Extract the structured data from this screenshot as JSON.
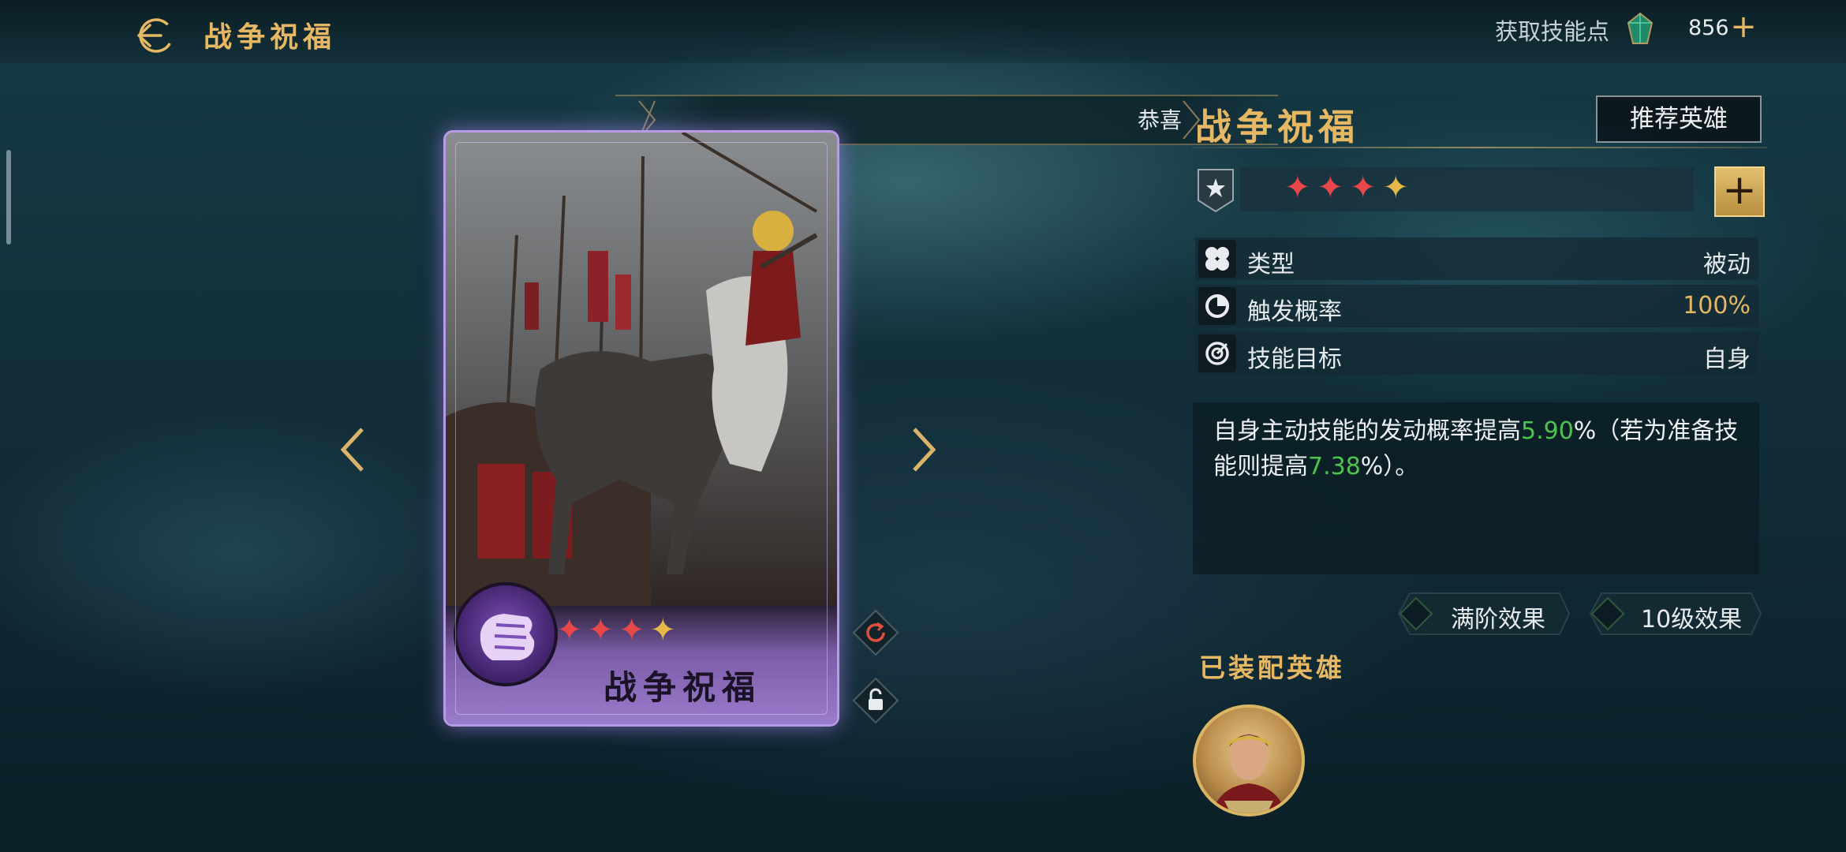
{
  "header": {
    "title": "战争祝福",
    "skill_points_label": "获取技能点",
    "skill_points_value": "856",
    "plus_symbol": "+"
  },
  "banner": {
    "visible_text": "恭喜"
  },
  "card": {
    "name": "战争祝福",
    "stars": [
      {
        "symbol": "✦",
        "color": "#e8474a"
      },
      {
        "symbol": "✦",
        "color": "#e8474a"
      },
      {
        "symbol": "✦",
        "color": "#e8474a"
      },
      {
        "symbol": "✦",
        "color": "#e6b84a"
      }
    ],
    "frame_color": "#b99ae6"
  },
  "skill": {
    "title": "战争祝福",
    "recommend_label": "推荐英雄",
    "level_stars": [
      {
        "symbol": "✦",
        "color": "#e8474a"
      },
      {
        "symbol": "✦",
        "color": "#e8474a"
      },
      {
        "symbol": "✦",
        "color": "#e8474a"
      },
      {
        "symbol": "✦",
        "color": "#e6b84a"
      }
    ],
    "level_plus": "+",
    "stats": [
      {
        "label": "类型",
        "value": "被动",
        "icon": "clover-icon"
      },
      {
        "label": "触发概率",
        "value": "100%",
        "icon": "pie-chart-icon"
      },
      {
        "label": "技能目标",
        "value": "自身",
        "icon": "target-icon"
      }
    ],
    "description": {
      "part1": "自身主动技能的发动概率提高",
      "value1": "5.90",
      "part2": "%（若为准备技能则提高",
      "value2": "7.38",
      "part3": "%）。"
    },
    "effect_buttons": [
      "满阶效果",
      "10级效果"
    ]
  },
  "equipped": {
    "title": "已装配英雄"
  },
  "colors": {
    "gold": "#e6b864",
    "highlight_green": "#4fc34f",
    "star_red": "#e8474a"
  }
}
